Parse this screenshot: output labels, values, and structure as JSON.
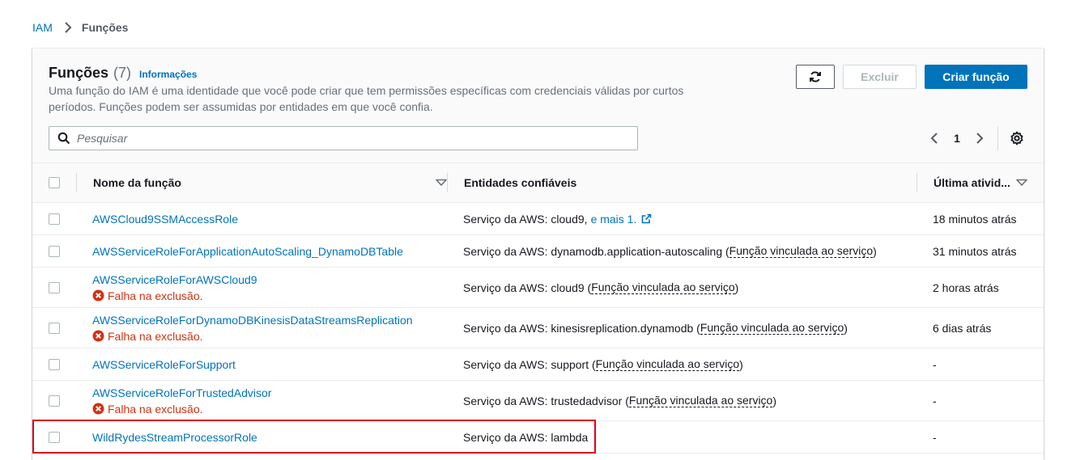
{
  "breadcrumb": {
    "root": "IAM",
    "current": "Funções"
  },
  "header": {
    "title": "Funções",
    "count": "(7)",
    "info_link": "Informações",
    "description": "Uma função do IAM é uma identidade que você pode criar que tem permissões específicas com credenciais válidas por curtos períodos. Funções podem ser assumidas por entidades em que você confia.",
    "delete_label": "Excluir",
    "create_label": "Criar função"
  },
  "search": {
    "placeholder": "Pesquisar",
    "value": ""
  },
  "pagination": {
    "current_page": "1"
  },
  "table": {
    "columns": {
      "name": "Nome da função",
      "trusted": "Entidades confiáveis",
      "last_activity": "Última ativid..."
    },
    "rows": [
      {
        "name": "AWSCloud9SSMAccessRole",
        "error": "",
        "trusted_prefix": "Serviço da AWS: cloud9,",
        "trusted_link": "e mais 1.",
        "trusted_suffix": "",
        "last_activity": "18 minutos atrás"
      },
      {
        "name": "AWSServiceRoleForApplicationAutoScaling_DynamoDBTable",
        "error": "",
        "trusted_prefix": "Serviço da AWS: dynamodb.application-autoscaling (",
        "trusted_link": "",
        "trusted_suffix": "Função vinculada ao serviço",
        "last_activity": "31 minutos atrás"
      },
      {
        "name": "AWSServiceRoleForAWSCloud9",
        "error": "Falha na exclusão.",
        "trusted_prefix": "Serviço da AWS: cloud9 (",
        "trusted_link": "",
        "trusted_suffix": "Função vinculada ao serviço",
        "last_activity": "2 horas atrás"
      },
      {
        "name": "AWSServiceRoleForDynamoDBKinesisDataStreamsReplication",
        "error": "Falha na exclusão.",
        "trusted_prefix": "Serviço da AWS: kinesisreplication.dynamodb (",
        "trusted_link": "",
        "trusted_suffix": "Função vinculada ao serviço",
        "last_activity": "6 dias atrás"
      },
      {
        "name": "AWSServiceRoleForSupport",
        "error": "",
        "trusted_prefix": "Serviço da AWS: support (",
        "trusted_link": "",
        "trusted_suffix": "Função vinculada ao serviço",
        "last_activity": "-"
      },
      {
        "name": "AWSServiceRoleForTrustedAdvisor",
        "error": "Falha na exclusão.",
        "trusted_prefix": "Serviço da AWS: trustedadvisor (",
        "trusted_link": "",
        "trusted_suffix": "Função vinculada ao serviço",
        "last_activity": "-"
      },
      {
        "name": "WildRydesStreamProcessorRole",
        "error": "",
        "trusted_prefix": "Serviço da AWS: lambda",
        "trusted_link": "",
        "trusted_suffix": "",
        "last_activity": "-"
      }
    ]
  },
  "icons": {
    "refresh": "refresh-icon",
    "search": "search-icon",
    "settings": "gear-icon",
    "external": "external-link-icon",
    "error": "error-icon",
    "sort": "caret-down-icon"
  },
  "colors": {
    "link": "#0073bb",
    "primary": "#0073bb",
    "error": "#d13212",
    "highlight": "#e0001b"
  }
}
